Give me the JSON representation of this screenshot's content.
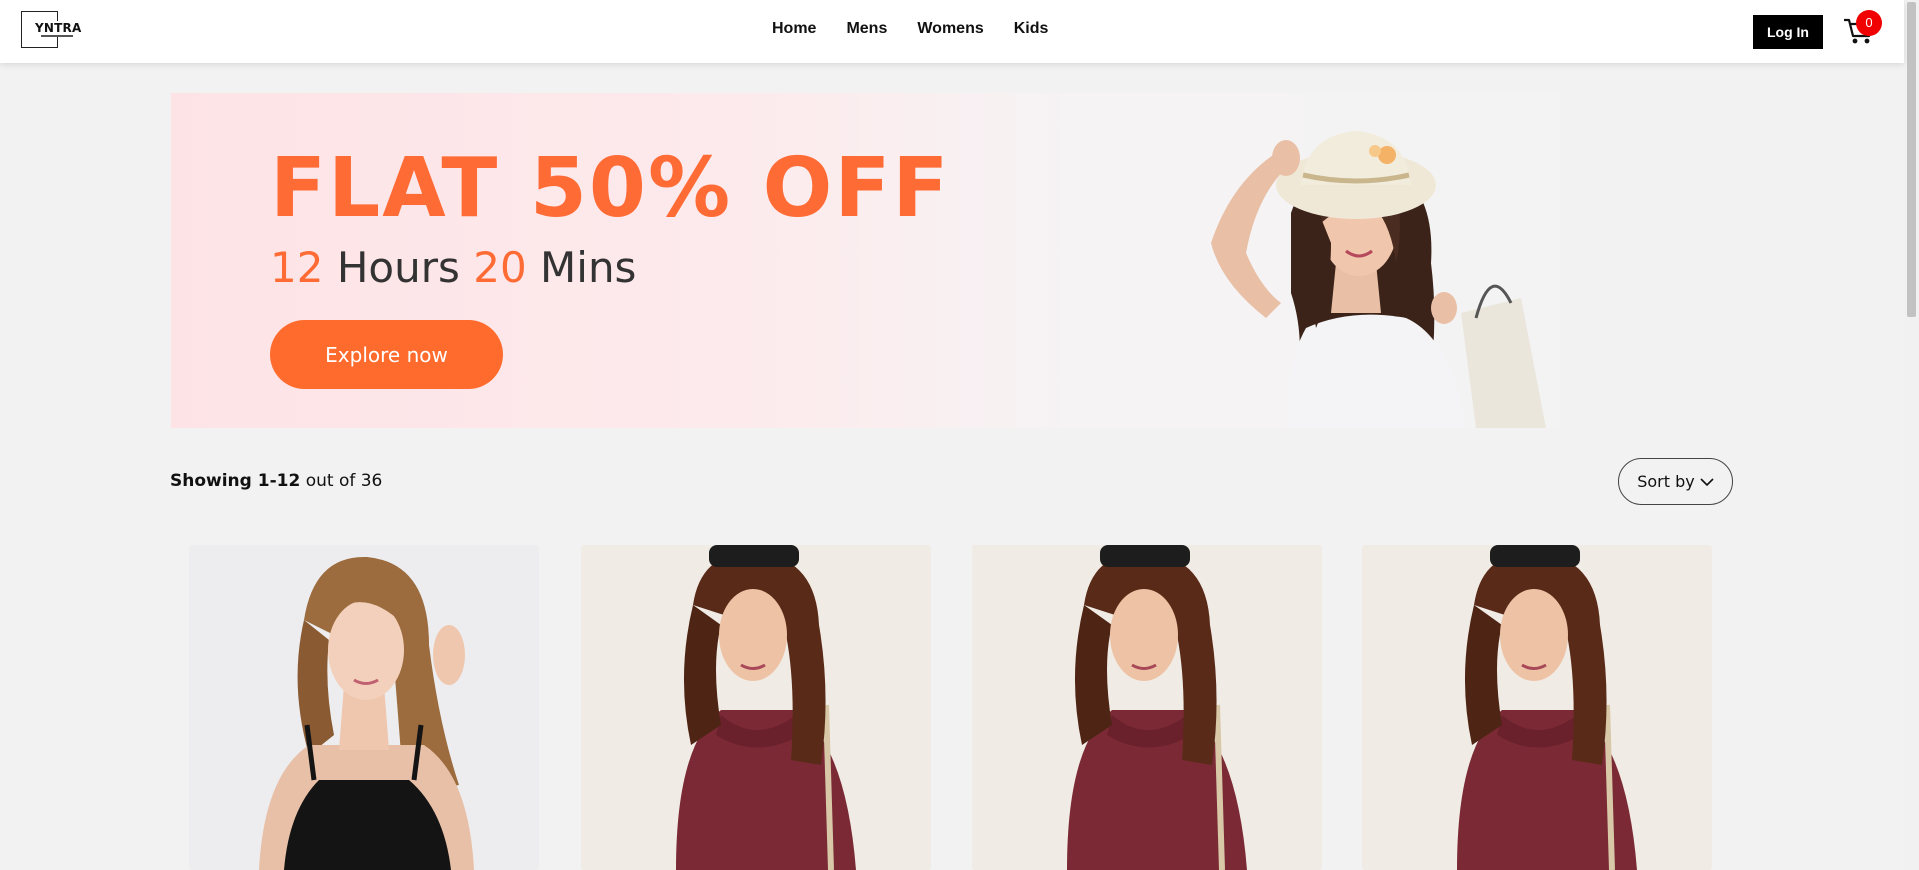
{
  "brand": {
    "logo_text": "YNTRA"
  },
  "nav": {
    "items": [
      "Home",
      "Mens",
      "Womens",
      "Kids"
    ]
  },
  "header": {
    "login_label": "Log In",
    "cart_count": "0"
  },
  "banner": {
    "title": "FLAT 50% OFF",
    "timer_hours": "12",
    "timer_hours_label": "Hours",
    "timer_mins": "20",
    "timer_mins_label": "Mins",
    "cta_label": "Explore now"
  },
  "results": {
    "range": "Showing 1-12",
    "total_text": "out of 36",
    "sort_label": "Sort by"
  },
  "products": [
    {
      "image": "woman-black-tank-top"
    },
    {
      "image": "woman-maroon-hoodie"
    },
    {
      "image": "woman-maroon-hoodie"
    },
    {
      "image": "woman-maroon-hoodie"
    }
  ],
  "colors": {
    "accent": "#ff6b35",
    "badge": "#f00000",
    "header_bg": "#ffffff",
    "page_bg": "#f2f2f3"
  }
}
